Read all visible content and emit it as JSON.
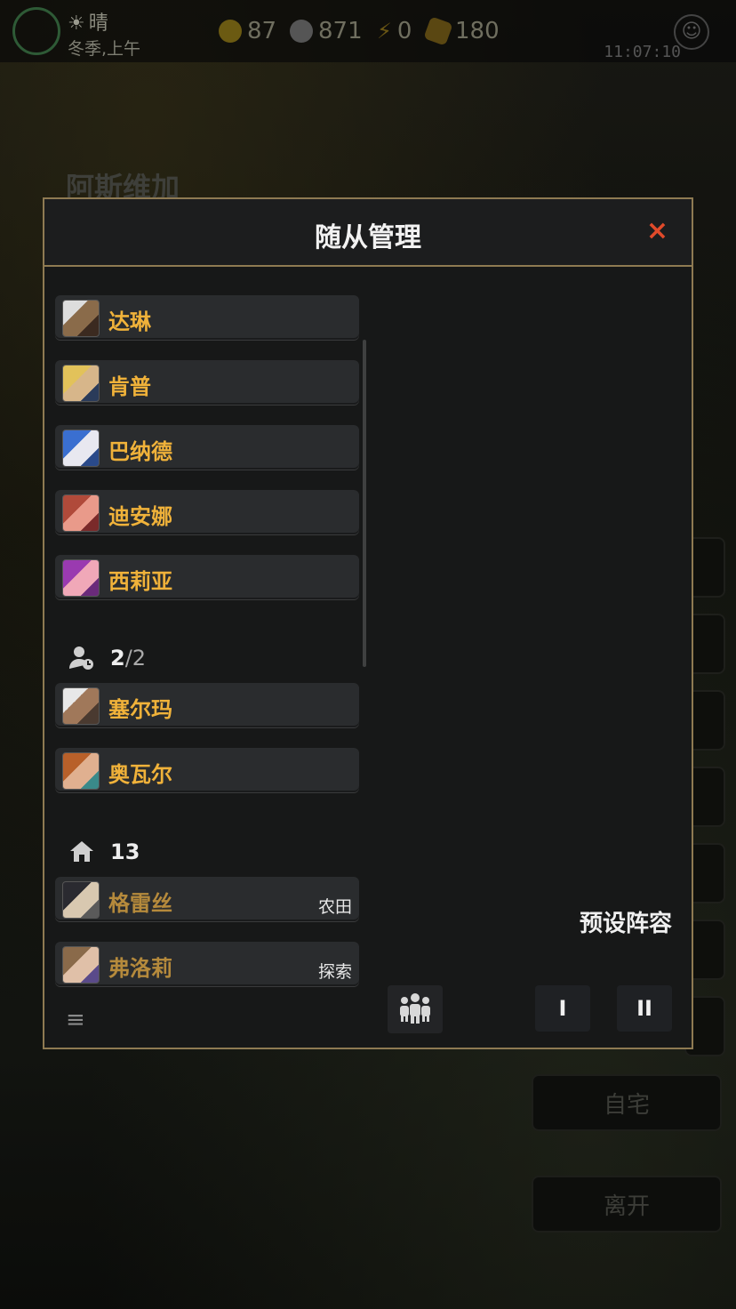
{
  "status": {
    "weather": "晴",
    "season_time": "冬季,上午",
    "gold": "87",
    "silver": "871",
    "energy": "0",
    "token": "180",
    "clock": "11:07:10"
  },
  "location": "阿斯维加",
  "side_buttons": {
    "home": "自宅",
    "leave": "离开"
  },
  "modal": {
    "title": "随从管理",
    "close": "×",
    "preset_label": "预设阵容",
    "preset_1": "I",
    "preset_2": "II"
  },
  "followers_main": [
    {
      "name": "达琳"
    },
    {
      "name": "肯普"
    },
    {
      "name": "巴纳德"
    },
    {
      "name": "迪安娜"
    },
    {
      "name": "西莉亚"
    }
  ],
  "section_party": {
    "current": "2",
    "total": "/2"
  },
  "followers_party": [
    {
      "name": "塞尔玛"
    },
    {
      "name": "奥瓦尔"
    }
  ],
  "section_home": {
    "count": "13"
  },
  "followers_home": [
    {
      "name": "格雷丝",
      "tag": "农田"
    },
    {
      "name": "弗洛莉",
      "tag": "探索"
    }
  ]
}
